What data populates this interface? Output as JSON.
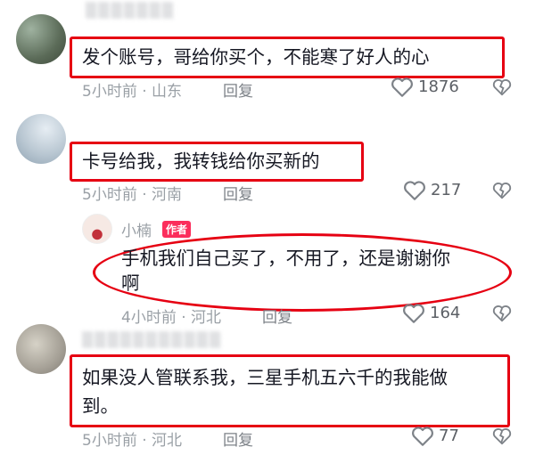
{
  "comments": [
    {
      "username": "",
      "text": "发个账号，哥给你买个，不能寒了好人的心",
      "time": "5小时前",
      "location": "山东",
      "reply_label": "回复",
      "likes": "1876"
    },
    {
      "username": "",
      "text": "卡号给我，我转钱给你买新的",
      "time": "5小时前",
      "location": "河南",
      "reply_label": "回复",
      "likes": "217"
    },
    {
      "username": "小楠",
      "author_badge": "作者",
      "text_line1": "手机我们自己买了，不用了，还是谢谢你",
      "text_line2": "啊",
      "time": "4小时前",
      "location": "河北",
      "reply_label": "回复",
      "likes": "164"
    },
    {
      "username": "",
      "text_line1": "如果没人管联系我，三星手机五六千的我能做",
      "text_line2": "到。",
      "time": "5小时前",
      "location": "河北",
      "reply_label": "回复",
      "likes": "77"
    }
  ],
  "colors": {
    "highlight": "#e60012",
    "author_badge": "#fb2e5c"
  }
}
